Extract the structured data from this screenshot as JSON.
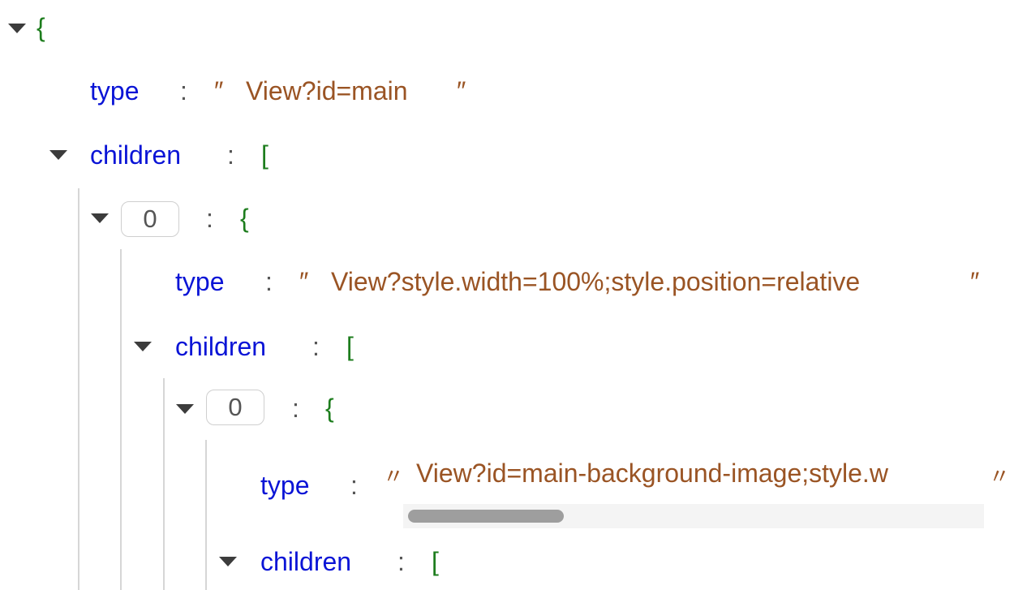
{
  "tree": {
    "root_open": "{",
    "root_type_key": "type",
    "root_type_value": "View?id=main",
    "root_children_key": "children",
    "root_children_open": "[",
    "item0_index": "0",
    "item0_open": "{",
    "item0_type_key": "type",
    "item0_type_value": "View?style.width=100%;style.position=relative",
    "item0_children_key": "children",
    "item0_children_open": "[",
    "item00_index": "0",
    "item00_open": "{",
    "item00_type_key": "type",
    "item00_type_value": "View?id=main-background-image;style.w",
    "item00_children_key": "children",
    "item00_children_open": "["
  },
  "symbols": {
    "colon": ":",
    "quote_open": "″",
    "quote_close": "″",
    "quote_small": "〃"
  }
}
